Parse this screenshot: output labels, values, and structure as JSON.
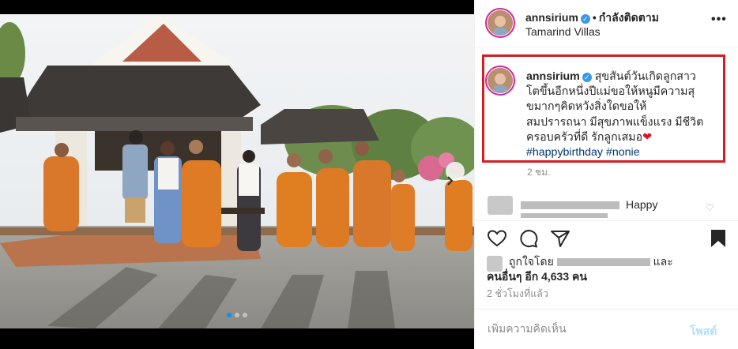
{
  "post": {
    "username": "annsirium",
    "follow_separator": "•",
    "follow_state": "กำลังติดตาม",
    "location": "Tamarind Villas",
    "more": "•••"
  },
  "caption": {
    "username": "annsirium",
    "lines": [
      "สุขสันต์วันเกิดลูกสาว",
      "โตขึ้นอีกหนึ่งปีแม่ขอให้หนูมีความสุ",
      "ขมากๆคิดหวังสิ่งใดขอให้",
      "สมปรารถนา มีสุขภาพแข็งแรง มีชีวิต",
      "ครอบครัวที่ดี รักลูกเสมอ"
    ],
    "heart": "❤",
    "hashtags": [
      "#happybirthday",
      "#nonie"
    ],
    "time": "2 ชม."
  },
  "comment": {
    "text": "Happy"
  },
  "likes": {
    "prefix": "ถูกใจโดย",
    "suffix": "และ",
    "others_label": "คนอื่นๆ อีก 4,633 คน"
  },
  "post_age": "2 ชั่วโมงที่แล้ว",
  "comment_form": {
    "placeholder": "เพิ่มความคิดเห็น",
    "post_label": "โพสต์"
  },
  "colors": {
    "highlight_box": "#d21f26",
    "verified": "#3897f0",
    "hashtag": "#00376b",
    "post_button_disabled": "#b2dffc"
  },
  "icons": [
    "verified-badge-icon",
    "heart-icon",
    "comment-icon",
    "share-icon",
    "bookmark-icon",
    "chevron-right-icon",
    "more-options-icon"
  ]
}
